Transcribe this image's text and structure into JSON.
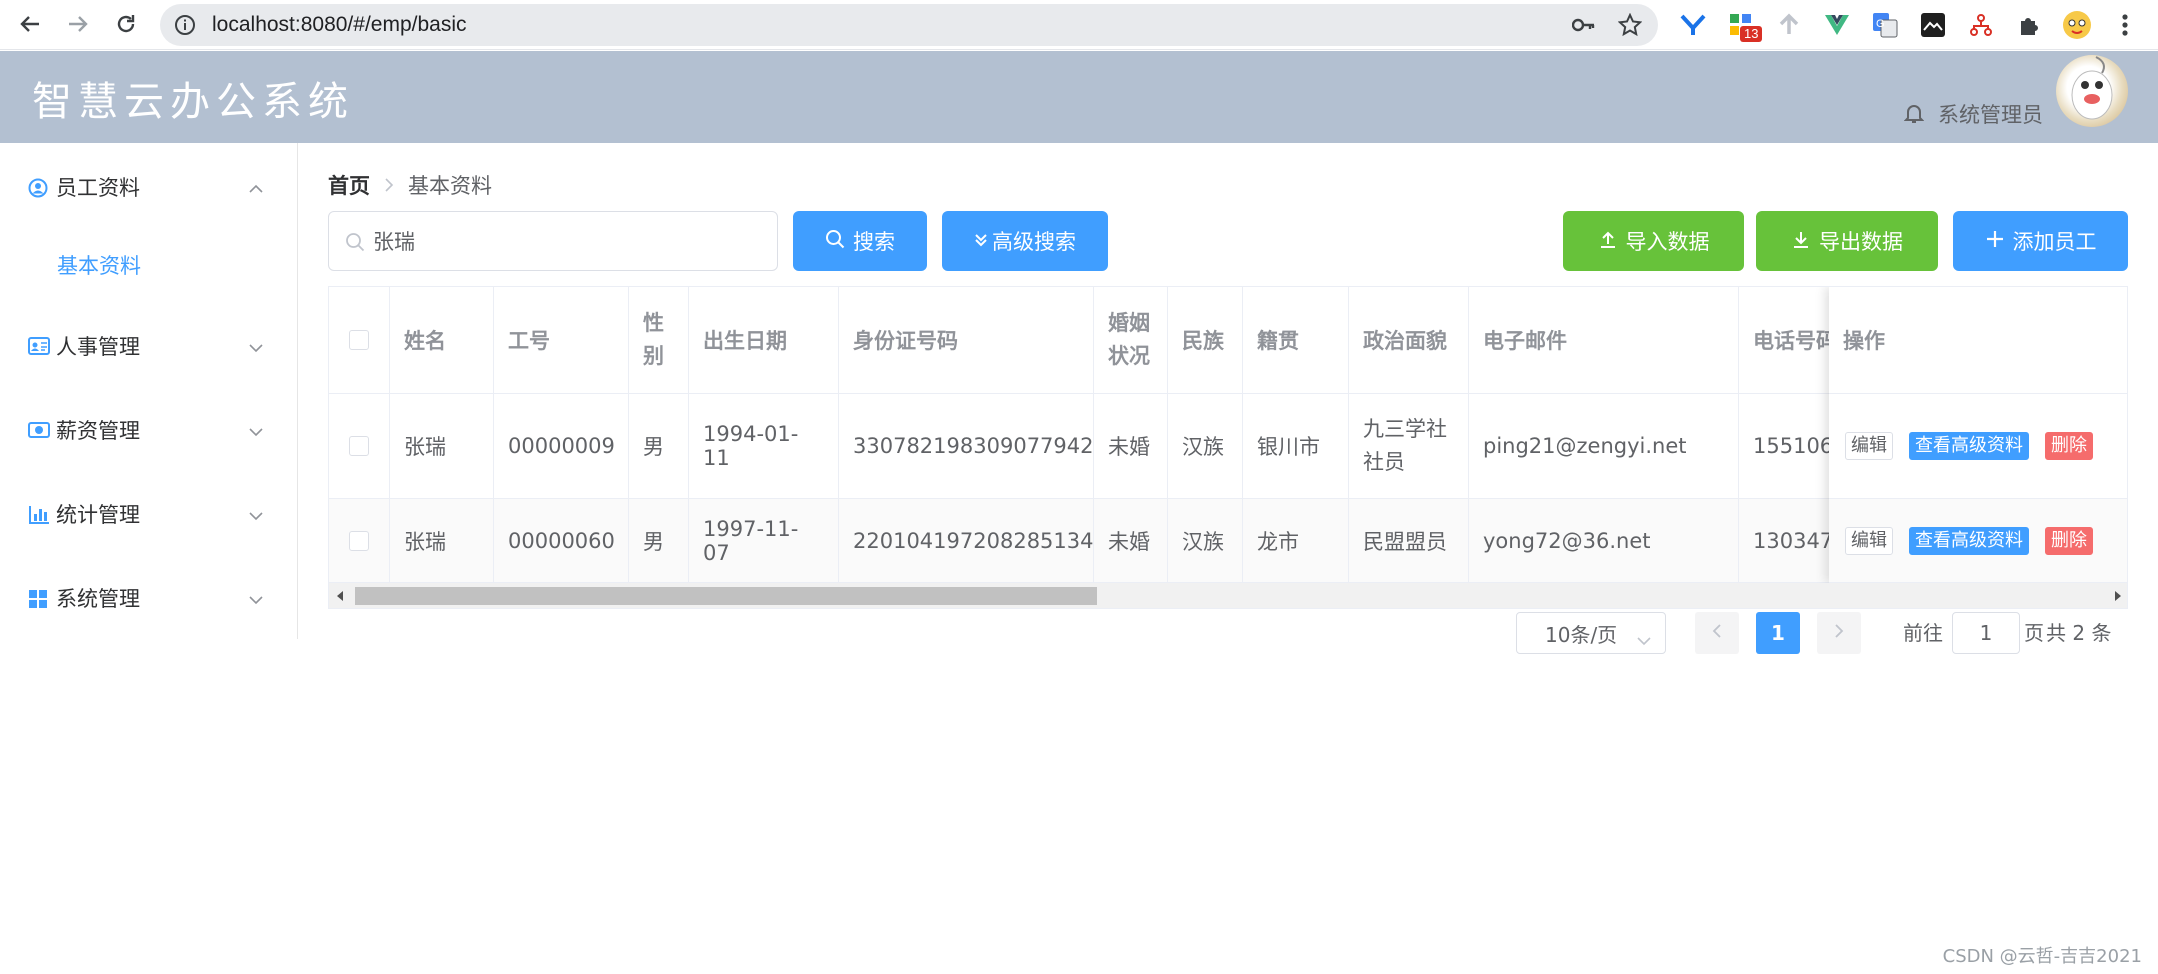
{
  "browser": {
    "url": "localhost:8080/#/emp/basic",
    "extension_badge": "13"
  },
  "header": {
    "title": "智慧云办公系统",
    "user_name": "系统管理员"
  },
  "sidebar": {
    "items": [
      {
        "label": "员工资料",
        "icon": "user-circle-icon",
        "expanded": true
      },
      {
        "label": "人事管理",
        "icon": "id-card-icon"
      },
      {
        "label": "薪资管理",
        "icon": "money-icon"
      },
      {
        "label": "统计管理",
        "icon": "chart-icon"
      },
      {
        "label": "系统管理",
        "icon": "windows-icon"
      }
    ],
    "sub_items": [
      {
        "label": "基本资料",
        "active": true
      }
    ]
  },
  "breadcrumb": {
    "home": "首页",
    "current": "基本资料"
  },
  "toolbar": {
    "search_value": "张瑞",
    "search_button": "搜索",
    "advanced_button": "高级搜索",
    "import_button": "导入数据",
    "export_button": "导出数据",
    "add_button": "添加员工"
  },
  "table": {
    "headers": {
      "name": "姓名",
      "work_id": "工号",
      "gender_1": "性",
      "gender_2": "别",
      "birthday": "出生日期",
      "id_card": "身份证号码",
      "wedlock_1": "婚姻",
      "wedlock_2": "状况",
      "nation": "民族",
      "native_place": "籍贯",
      "politic": "政治面貌",
      "email": "电子邮件",
      "phone": "电话号码",
      "actions": "操作"
    },
    "rows": [
      {
        "name": "张瑞",
        "work_id": "00000009",
        "gender": "男",
        "birthday": "1994-01-11",
        "id_card": "330782198309077942",
        "wedlock": "未婚",
        "nation": "汉族",
        "native_place": "银川市",
        "politic_1": "九三学社",
        "politic_2": "社员",
        "email": "ping21@zengyi.net",
        "phone": "155106"
      },
      {
        "name": "张瑞",
        "work_id": "00000060",
        "gender": "男",
        "birthday": "1997-11-07",
        "id_card": "220104197208285134",
        "wedlock": "未婚",
        "nation": "汉族",
        "native_place": "龙市",
        "politic_1": "民盟盟员",
        "email": "yong72@36.net",
        "phone": "130347"
      }
    ],
    "row_actions": {
      "edit": "编辑",
      "view": "查看高级资料",
      "delete": "删除"
    }
  },
  "pagination": {
    "page_size": "10条/页",
    "current_page": "1",
    "goto_prefix": "前往",
    "goto_value": "1",
    "goto_suffix": "页",
    "total": "共 2 条"
  },
  "watermark": "CSDN @云哲-吉吉2021",
  "colors": {
    "primary": "#409eff",
    "success": "#67c23a",
    "danger": "#f56c6c",
    "header_bg": "#b3c0d1"
  }
}
